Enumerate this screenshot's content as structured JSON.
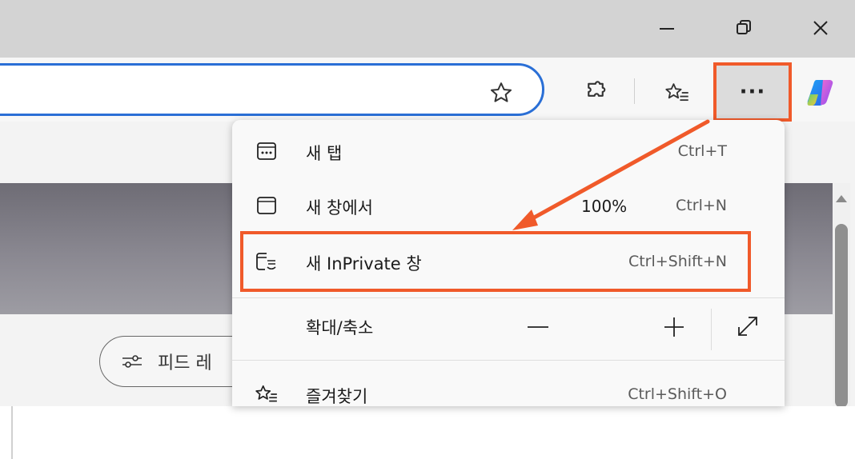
{
  "window": {
    "minimize_icon": "minimize-icon",
    "restore_icon": "restore-icon",
    "close_icon": "close-icon"
  },
  "toolbar": {
    "favorite_star_icon": "star-outline-icon",
    "extensions_icon": "puzzle-icon",
    "favorites_icon": "favorites-icon",
    "more_label": "···",
    "copilot_icon": "copilot-icon"
  },
  "page": {
    "feed_label": "피드 레"
  },
  "menu": {
    "items": [
      {
        "label": "새 탭",
        "shortcut": "Ctrl+T",
        "icon": "new-tab-icon"
      },
      {
        "label": "새 창에서",
        "shortcut": "Ctrl+N",
        "icon": "new-window-icon"
      },
      {
        "label": "새 InPrivate 창",
        "shortcut": "Ctrl+Shift+N",
        "icon": "inprivate-icon"
      },
      {
        "label": "확대/축소",
        "zoom_value": "100%",
        "icon": ""
      },
      {
        "label": "즐겨찾기",
        "shortcut": "Ctrl+Shift+O",
        "icon": "favorites-icon"
      }
    ]
  },
  "colors": {
    "highlight": "#f05a2a",
    "address_border": "#2a6fd6",
    "titlebar": "#d3d3d3"
  }
}
